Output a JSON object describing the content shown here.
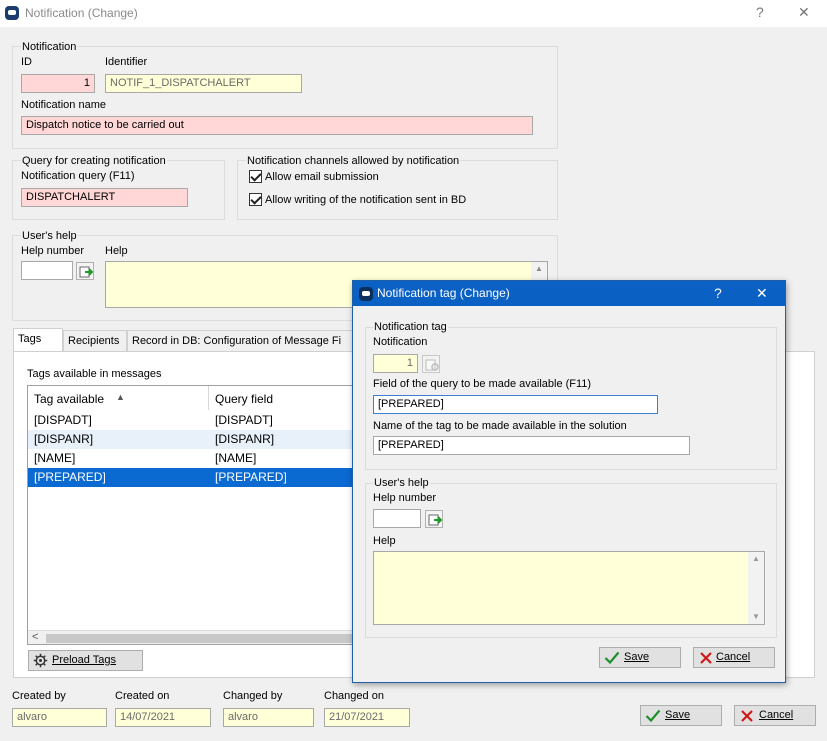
{
  "window": {
    "title": "Notification (Change)",
    "help_glyph": "?",
    "close_glyph": "✕"
  },
  "notification": {
    "group_title": "Notification",
    "id_label": "ID",
    "id_value": "1",
    "identifier_label": "Identifier",
    "identifier_value": "NOTIF_1_DISPATCHALERT",
    "name_label": "Notification name",
    "name_value": "Dispatch notice to be carried out"
  },
  "query": {
    "group_title": "Query for creating notification",
    "label": "Notification query (F11)",
    "value": "DISPATCHALERT"
  },
  "channels": {
    "group_title": "Notification channels allowed by notification",
    "email_label": "Allow email submission",
    "email_checked": true,
    "bd_label": "Allow writing of the notification sent in BD",
    "bd_checked": true
  },
  "users_help": {
    "group_title": "User's help",
    "help_number_label": "Help number",
    "help_number_value": "",
    "help_label": "Help",
    "help_value": ""
  },
  "tabs": [
    {
      "label": "Tags",
      "active": true
    },
    {
      "label": "Recipients",
      "active": false
    },
    {
      "label": "Record in DB: Configuration of Message Fi",
      "active": false
    }
  ],
  "tags_panel": {
    "title": "Tags available in messages",
    "columns": [
      "Tag available",
      "Query field"
    ],
    "rows": [
      {
        "tag": "[DISPADT]",
        "field": "[DISPADT]"
      },
      {
        "tag": "[DISPANR]",
        "field": "[DISPANR]"
      },
      {
        "tag": "[NAME]",
        "field": "[NAME]"
      },
      {
        "tag": "[PREPARED]",
        "field": "[PREPARED]"
      }
    ],
    "selected_row": 3,
    "preload_button": "Preload Tags",
    "scroll_left_glyph": "<"
  },
  "footer": {
    "created_by_label": "Created by",
    "created_by_value": "alvaro",
    "created_on_label": "Created on",
    "created_on_value": "14/07/2021",
    "changed_by_label": "Changed by",
    "changed_by_value": "alvaro",
    "changed_on_label": "Changed on",
    "changed_on_value": "21/07/2021",
    "save_label": "Save",
    "cancel_label": "Cancel"
  },
  "dialog": {
    "title": "Notification tag (Change)",
    "help_glyph": "?",
    "close_glyph": "✕",
    "tag_group_title": "Notification tag",
    "notification_label": "Notification",
    "notification_value": "1",
    "query_field_label": "Field of the query to be made available (F11)",
    "query_field_value": "[PREPARED]",
    "tag_name_label": "Name of the tag to be made available in the solution",
    "tag_name_value": "[PREPARED]",
    "help_group_title": "User's help",
    "help_number_label": "Help number",
    "help_number_value": "",
    "help_label": "Help",
    "help_value": "",
    "save_label": "Save",
    "cancel_label": "Cancel"
  },
  "colors": {
    "required_bg": "#ffd7d7",
    "readonly_bg": "#ffffd8",
    "selection": "#0a6ad1",
    "dialog_title_bg": "#0b60c4"
  }
}
